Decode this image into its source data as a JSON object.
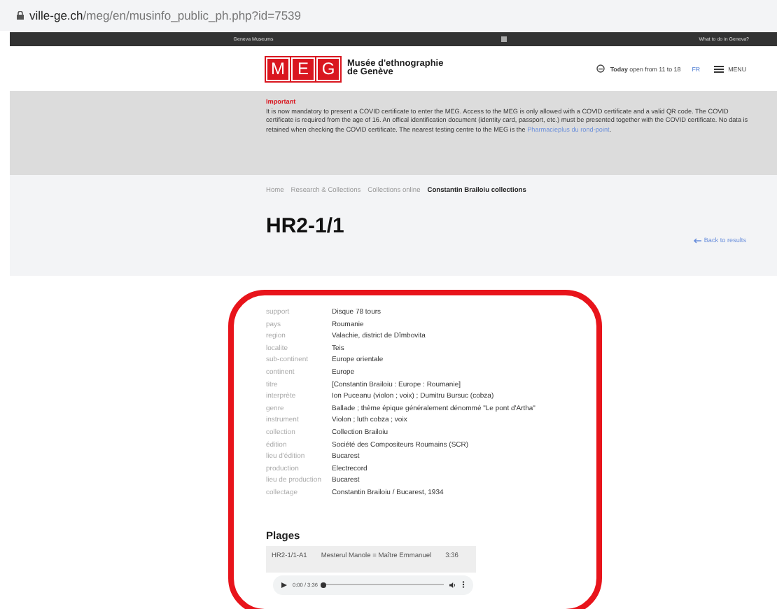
{
  "address_bar": {
    "domain": "ville-ge.ch",
    "path": "/meg/en/musinfo_public_ph.php?id=7539"
  },
  "top_bar": {
    "left": "Geneva Museums",
    "right": "What to do in Geneva?"
  },
  "header": {
    "logo_letters": [
      "M",
      "E",
      "G"
    ],
    "museum_name": [
      "Musée d'ethnographie",
      "de Genève"
    ],
    "hours": "**Today** open from 11 to 18",
    "language": "FR",
    "menu": "MENU"
  },
  "notice": {
    "title": "Important",
    "text": "It is now mandatory to present a COVID certificate to enter the MEG. Access to the MEG is only allowed with a COVID certificate and a valid QR code. The COVID certificate is required from the age of 16. An offical identification document (identity card, passport, etc.) must be presented together with the COVID certificate. No data is retained when checking the COVID certificate. The nearest testing centre to the MEG is the ",
    "link": "Pharmacieplus du rond-point",
    "text_end": "."
  },
  "breadcrumb": [
    {
      "label": "Home",
      "current": false
    },
    {
      "label": "Research & Collections",
      "current": false
    },
    {
      "label": "Collections online",
      "current": false
    },
    {
      "label": "Constantin Brailoiu collections",
      "current": true
    }
  ],
  "title": "HR2-1/1",
  "back_link": "Back to results",
  "fields": [
    {
      "label": "support",
      "value": "Disque 78 tours"
    },
    {
      "label": "pays",
      "value": "Roumanie"
    },
    {
      "label": "region",
      "value": "Valachie, district de Dîmbovita"
    },
    {
      "label": "localite",
      "value": "Teis"
    },
    {
      "label": "sub-continent",
      "value": "Europe orientale"
    },
    {
      "label": "continent",
      "value": "Europe"
    },
    {
      "label": "titre",
      "value": "[Constantin Brailoiu : Europe : Roumanie]"
    },
    {
      "label": "interprète",
      "value": "Ion Puceanu (violon ; voix) ; Dumitru Bursuc (cobza)"
    },
    {
      "label": "genre",
      "value": "Ballade ; thème épique généralement dénommé \"Le pont d'Artha\""
    },
    {
      "label": "instrument",
      "value": "Violon ; luth cobza ; voix"
    },
    {
      "label": "collection",
      "value": "Collection Brailoiu"
    },
    {
      "label": "édition",
      "value": "Société des Compositeurs Roumains (SCR)"
    },
    {
      "label": "lieu d'édition",
      "value": "Bucarest"
    },
    {
      "label": "production",
      "value": "Electrecord"
    },
    {
      "label": "lieu de production",
      "value": "Bucarest"
    },
    {
      "label": "collectage",
      "value": "Constantin Brailoiu / Bucarest, 1934"
    }
  ],
  "tracks_heading": "Plages",
  "tracks": [
    {
      "code": "HR2-1/1-A1",
      "title": "Mesterul Manole = Maître Emmanuel",
      "duration": "3:36"
    }
  ],
  "player": {
    "time": "0:00 / 3:36",
    "level": 0
  }
}
